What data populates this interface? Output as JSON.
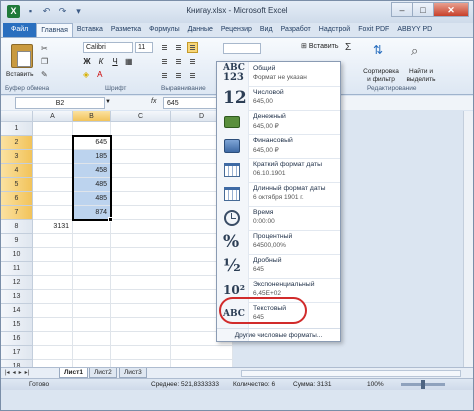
{
  "window": {
    "title": "Книгау.xlsx - Microsoft Excel"
  },
  "ribbon_tabs": [
    "Файл",
    "Главная",
    "Вставка",
    "Разметка",
    "Формулы",
    "Данные",
    "Рецензир",
    "Вид",
    "Разработ",
    "Надстрой",
    "Foxit PDF",
    "ABBYY PD"
  ],
  "clipboard": {
    "paste_label": "Вставить",
    "group_label": "Буфер обмена"
  },
  "font": {
    "name": "Calibri",
    "size": "11",
    "group_label": "Шрифт"
  },
  "alignment": {
    "group_label": "Выравнивание"
  },
  "cells_group": {
    "insert_label": "Вставить"
  },
  "editing": {
    "sort_label": "Сортировка\nи фильтр",
    "find_label": "Найти и\nвыделить",
    "group_label": "Редактирование"
  },
  "formula_bar": {
    "name_box": "B2",
    "fx": "fx",
    "value": "645"
  },
  "columns": [
    "A",
    "B",
    "C",
    "D"
  ],
  "rows": [
    "1",
    "2",
    "3",
    "4",
    "5",
    "6",
    "7",
    "8",
    "9",
    "10",
    "11",
    "12",
    "13",
    "14",
    "15",
    "16",
    "17",
    "18"
  ],
  "cells": {
    "B2": "645",
    "B3": "185",
    "B4": "458",
    "B5": "485",
    "B6": "485",
    "B7": "874",
    "A8": "3131"
  },
  "number_formats": [
    {
      "icon": "ABC 123",
      "name": "Общий",
      "sample": "Формат не указан"
    },
    {
      "icon": "12",
      "name": "Числовой",
      "sample": "645,00"
    },
    {
      "icon": "money",
      "name": "Денежный",
      "sample": "645,00 ₽"
    },
    {
      "icon": "fin",
      "name": "Финансовый",
      "sample": "645,00 ₽"
    },
    {
      "icon": "calendar",
      "name": "Краткий формат даты",
      "sample": "06.10.1901"
    },
    {
      "icon": "calendar",
      "name": "Длинный формат даты",
      "sample": "6 октября 1901 г."
    },
    {
      "icon": "clock",
      "name": "Время",
      "sample": "0:00:00"
    },
    {
      "icon": "%",
      "name": "Процентный",
      "sample": "64500,00%"
    },
    {
      "icon": "½",
      "name": "Дробный",
      "sample": "645"
    },
    {
      "icon": "10²",
      "name": "Экспоненциальный",
      "sample": "6,45E+02"
    },
    {
      "icon": "ABC",
      "name": "Текстовый",
      "sample": "645"
    }
  ],
  "more_formats_label": "Другие числовые форматы...",
  "sheets": [
    "Лист1",
    "Лист2",
    "Лист3"
  ],
  "status": {
    "ready": "Готово",
    "average": "Среднее: 521,8333333",
    "count": "Количество: 6",
    "sum": "Сумма: 3131",
    "zoom": "100%"
  }
}
